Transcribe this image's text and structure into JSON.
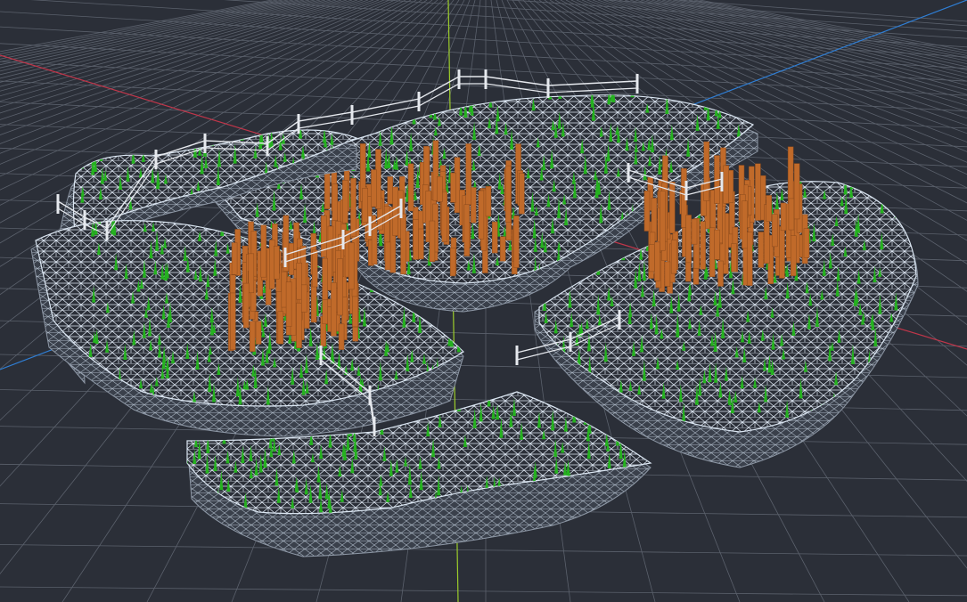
{
  "viewport": {
    "background_color": "#2b2f38",
    "grid_color": "#5b616c",
    "axis_x_color": "#c0364a",
    "axis_z_color": "#2f7fd6",
    "axis_y_color": "#9ccc2a"
  },
  "scene": {
    "mesh_color": "#dbe6f2",
    "mesh_shade_color": "#8e98a6",
    "grass_color": "#25b21f",
    "tree_color": "#c06a2a",
    "fence_color": "#e6e9ee",
    "islands": [
      {
        "name": "island-top-center",
        "has_trees": true,
        "has_fence": true
      },
      {
        "name": "island-left",
        "has_trees": true,
        "has_fence": true
      },
      {
        "name": "island-right",
        "has_trees": true,
        "has_fence": true
      },
      {
        "name": "island-bottom",
        "has_trees": false,
        "has_fence": true
      },
      {
        "name": "island-far-left-rim",
        "has_trees": false,
        "has_fence": true
      }
    ]
  }
}
